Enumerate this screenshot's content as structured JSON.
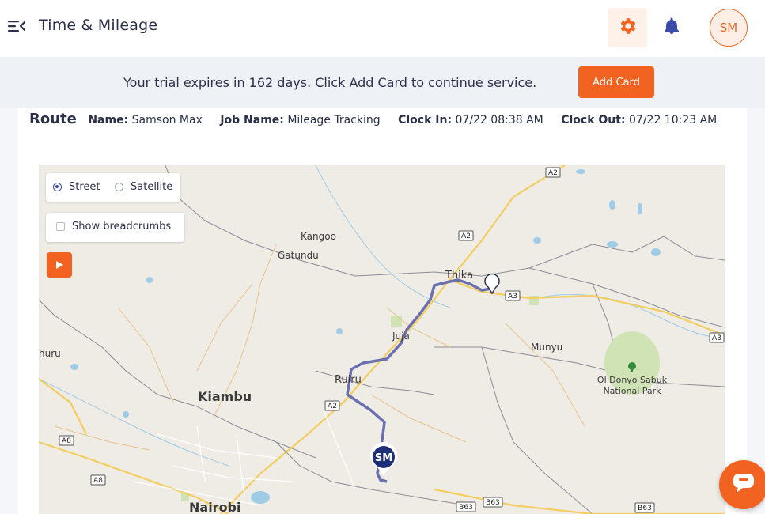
{
  "header": {
    "title": "Time & Mileage",
    "avatar_initials": "SM",
    "icons": {
      "menu": "menu-collapse-icon",
      "settings": "gear-icon",
      "notifications": "bell-icon"
    },
    "accent_color": "#f26322"
  },
  "banner": {
    "text": "Your trial expires in 162 days. Click Add Card to continue service.",
    "button_label": "Add Card"
  },
  "route": {
    "title": "Route",
    "name_label": "Name:",
    "name_value": "Samson Max",
    "job_label": "Job Name:",
    "job_value": "Mileage Tracking",
    "clock_in_label": "Clock In:",
    "clock_in_value": "07/22 08:38 AM",
    "clock_out_label": "Clock Out:",
    "clock_out_value": "07/22 10:23 AM"
  },
  "map": {
    "layer_options": [
      "Street",
      "Satellite"
    ],
    "selected_layer": "Street",
    "breadcrumbs_label": "Show breadcrumbs",
    "breadcrumbs_checked": false,
    "marker_initials": "SM",
    "route_color": "#6a6fb0",
    "places": {
      "thika": "Thika",
      "kangoo": "Kangoo",
      "gatundu": "Gatundu",
      "juja": "Juja",
      "munyu": "Munyu",
      "ruiru": "Ruiru",
      "kiambu": "Kiambu",
      "nairobi": "Nairobi",
      "hururu": "huru",
      "park_line1": "Ol Donyo Sabuk",
      "park_line2": "National Park"
    },
    "road_shields": {
      "a2_top": "A2",
      "a2_mid": "A2",
      "a2_low": "A2",
      "a3_thika": "A3",
      "a3_east": "A3",
      "a8_left": "A8",
      "a8_low": "A8",
      "b63_a": "B63",
      "b63_b": "B63",
      "b63_c": "B63"
    }
  }
}
